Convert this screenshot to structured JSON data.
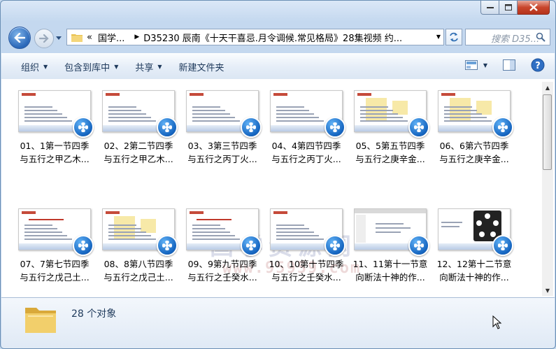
{
  "window": {
    "address_parts": [
      "«",
      "国学...",
      "D35230 辰南《十天干喜忌.月令调候.常见格局》28集视频 约..."
    ],
    "search_placeholder": "搜索 D35..."
  },
  "toolbar": {
    "organize": "组织",
    "include_library": "包含到库中",
    "share": "共享",
    "new_folder": "新建文件夹"
  },
  "files": [
    {
      "line1": "01、1第一节四季",
      "line2": "与五行之甲乙木...",
      "style": "plain"
    },
    {
      "line1": "02、2第二节四季",
      "line2": "与五行之甲乙木...",
      "style": "plain"
    },
    {
      "line1": "03、3第三节四季",
      "line2": "与五行之丙丁火...",
      "style": "plain"
    },
    {
      "line1": "04、4第四节四季",
      "line2": "与五行之丙丁火...",
      "style": "plain"
    },
    {
      "line1": "05、5第五节四季",
      "line2": "与五行之庚辛金...",
      "style": "yellow"
    },
    {
      "line1": "06、6第六节四季",
      "line2": "与五行之庚辛金...",
      "style": "yellow"
    },
    {
      "line1": "07、7第七节四季",
      "line2": "与五行之戊己土...",
      "style": "title"
    },
    {
      "line1": "08、8第八节四季",
      "line2": "与五行之戊己土...",
      "style": "yellow"
    },
    {
      "line1": "09、9第九节四季",
      "line2": "与五行之壬癸水...",
      "style": "title"
    },
    {
      "line1": "10、10第十节四季",
      "line2": "与五行之壬癸水...",
      "style": "plain"
    },
    {
      "line1": "11、11第十一节意",
      "line2": "向断法十神的作...",
      "style": "ppt"
    },
    {
      "line1": "12、12第十二节意",
      "line2": "向断法十神的作...",
      "style": "dark"
    }
  ],
  "watermark": {
    "line1": "国学资源网",
    "line2": "www.95959.com"
  },
  "status": {
    "count": "28 个对象"
  },
  "colors": {
    "accent": "#1e395b",
    "badge": "#1565c0"
  }
}
